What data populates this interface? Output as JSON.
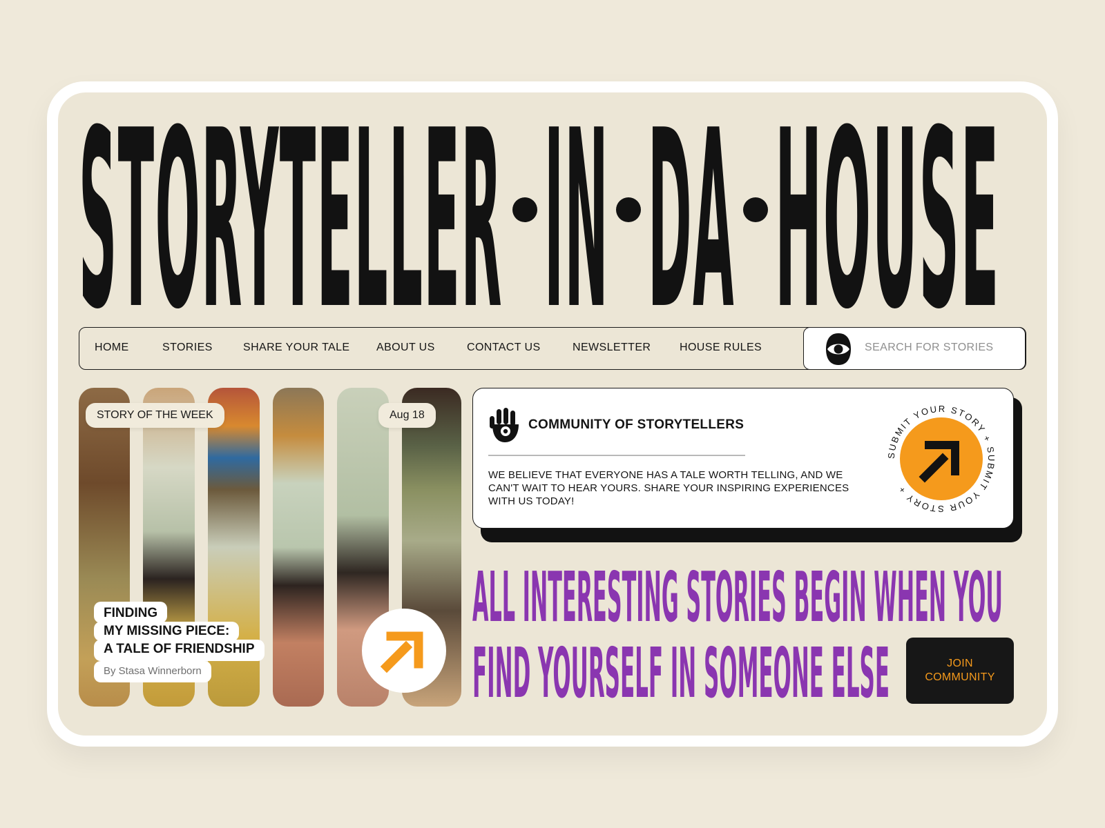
{
  "hero": {
    "title_words": [
      "STORYTELLER",
      "IN",
      "DA",
      "HOUSE"
    ]
  },
  "nav": {
    "items": [
      "HOME",
      "STORIES",
      "SHARE YOUR TALE",
      "ABOUT US",
      "CONTACT US",
      "NEWSLETTER",
      "HOUSE RULES"
    ],
    "search_placeholder": "SEARCH FOR STORIES",
    "search_icon": "eye-icon"
  },
  "feature": {
    "label": "STORY OF THE WEEK",
    "date": "Aug 18",
    "title_lines": [
      "FINDING",
      "MY MISSING PIECE:",
      "A TALE OF FRIENDSHIP"
    ],
    "author": "By Stasa Winnerborn",
    "button_icon": "arrow-up-right-icon"
  },
  "community": {
    "icon": "hand-eye-icon",
    "title": "COMMUNITY OF STORYTELLERS",
    "body_lines": [
      "WE BELIEVE THAT EVERYONE HAS A TALE WORTH TELLING, AND WE",
      "CAN'T WAIT TO HEAR YOURS. SHARE YOUR INSPIRING EXPERIENCES",
      "WITH US TODAY!"
    ],
    "badge_text": "SUBMIT YOUR STORY + SUBMIT YOUR STORY +"
  },
  "tagline": {
    "lines": [
      "ALL INTERESTING STORIES BEGIN WHEN YOU",
      "FIND YOURSELF IN SOMEONE ELSE"
    ]
  },
  "cta": {
    "join_lines": [
      "JOIN",
      "COMMUNITY"
    ]
  },
  "colors": {
    "background": "#ece6d6",
    "ink": "#121212",
    "accent_orange": "#f59a1c",
    "accent_purple": "#8a36b0"
  }
}
